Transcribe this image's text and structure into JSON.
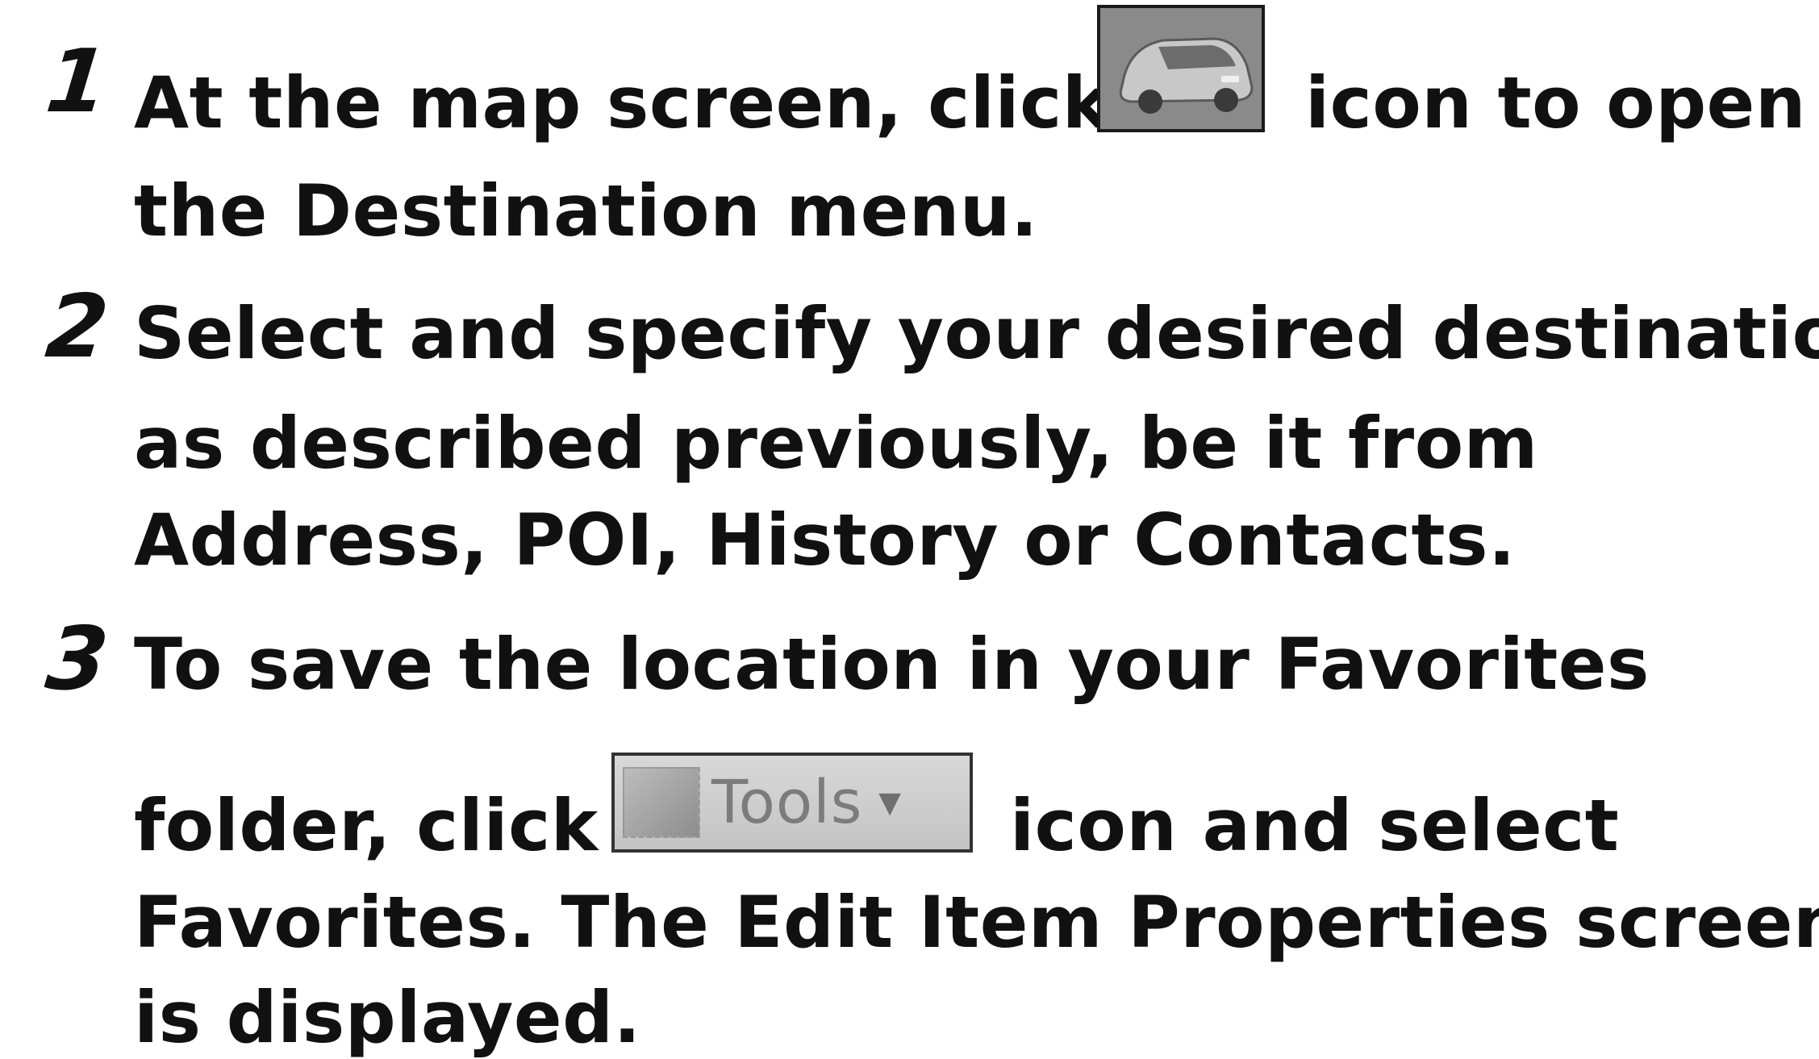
{
  "steps": [
    {
      "number": "1",
      "lines": [
        {
          "before": "At the map screen, click",
          "after": "icon to open"
        },
        {
          "text": "the Destination menu."
        }
      ],
      "icon": "car-icon"
    },
    {
      "number": "2",
      "lines": [
        {
          "text": "Select and specify your desired destination"
        },
        {
          "text": "as described previously, be it from"
        },
        {
          "text": "Address, POI, History or Contacts."
        }
      ]
    },
    {
      "number": "3",
      "lines": [
        {
          "text": "To save the location in your Favorites"
        },
        {
          "before": "folder, click",
          "after": "icon and select"
        },
        {
          "text": "Favorites.  The Edit Item Properties screen"
        },
        {
          "text": "is displayed."
        }
      ],
      "icon": "tools-button-icon",
      "icon_label": "Tools"
    }
  ]
}
